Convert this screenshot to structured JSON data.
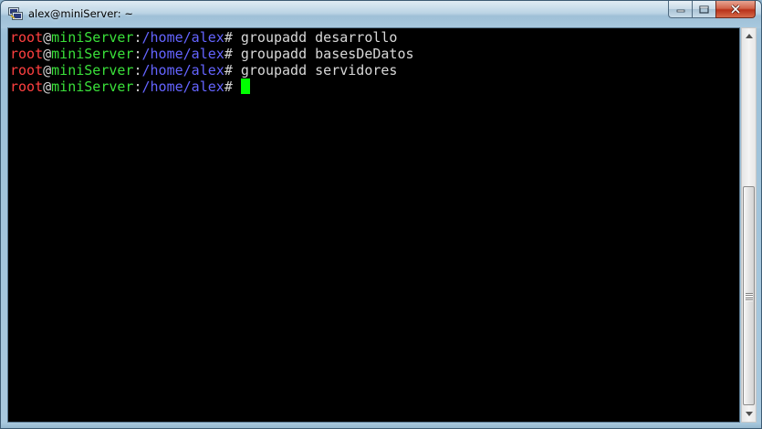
{
  "window": {
    "title": "alex@miniServer: ~",
    "app_icon": "putty-icon",
    "buttons": [
      "minimize-icon",
      "maximize-icon",
      "close-icon"
    ]
  },
  "terminal": {
    "colors": {
      "background": "#000000",
      "user": "#ff4040",
      "host": "#3ae03a",
      "path": "#6464ff",
      "text": "#d8d8d8",
      "cursor": "#00ff00"
    },
    "lines": [
      {
        "user": "root",
        "at": "@",
        "host": "miniServer",
        "colon": ":",
        "path": "/home/alex",
        "hash": "#",
        "command": " groupadd desarrollo"
      },
      {
        "user": "root",
        "at": "@",
        "host": "miniServer",
        "colon": ":",
        "path": "/home/alex",
        "hash": "#",
        "command": " groupadd basesDeDatos"
      },
      {
        "user": "root",
        "at": "@",
        "host": "miniServer",
        "colon": ":",
        "path": "/home/alex",
        "hash": "#",
        "command": " groupadd servidores"
      },
      {
        "user": "root",
        "at": "@",
        "host": "miniServer",
        "colon": ":",
        "path": "/home/alex",
        "hash": "#",
        "command": " "
      }
    ]
  }
}
